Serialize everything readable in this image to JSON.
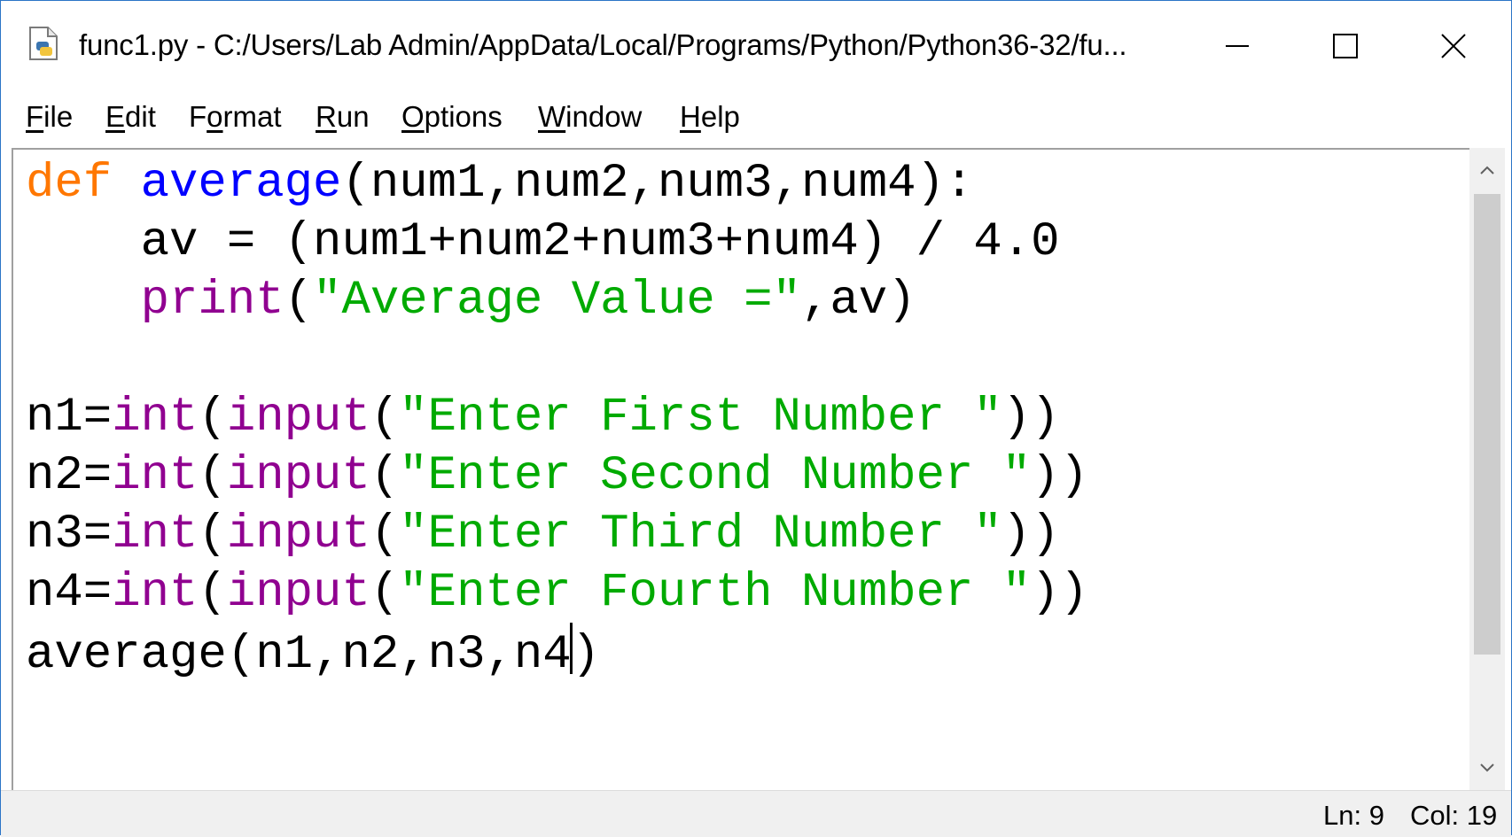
{
  "window": {
    "title": "func1.py - C:/Users/Lab Admin/AppData/Local/Programs/Python/Python36-32/fu...",
    "controls": {
      "minimize_icon": "minimize-icon",
      "maximize_icon": "maximize-icon",
      "close_icon": "close-icon"
    }
  },
  "menu": {
    "items": [
      {
        "accel": "F",
        "rest": "ile"
      },
      {
        "accel": "E",
        "rest": "dit"
      },
      {
        "pre": "F",
        "accel": "o",
        "rest": "rmat"
      },
      {
        "accel": "R",
        "rest": "un"
      },
      {
        "accel": "O",
        "rest": "ptions"
      },
      {
        "accel": "W",
        "rest": "indow"
      },
      {
        "accel": "H",
        "rest": "elp"
      }
    ]
  },
  "editor": {
    "lines": [
      {
        "segments": [
          {
            "t": "def",
            "c": "kw"
          },
          {
            "t": " ",
            "c": ""
          },
          {
            "t": "average",
            "c": "def"
          },
          {
            "t": "(num1,num2,num3,num4):",
            "c": ""
          }
        ]
      },
      {
        "segments": [
          {
            "t": "    av = (num1+num2+num3+num4) / 4.0",
            "c": ""
          }
        ]
      },
      {
        "segments": [
          {
            "t": "    ",
            "c": ""
          },
          {
            "t": "print",
            "c": "bi"
          },
          {
            "t": "(",
            "c": ""
          },
          {
            "t": "\"Average Value =\"",
            "c": "str"
          },
          {
            "t": ",av)",
            "c": ""
          }
        ]
      },
      {
        "segments": [
          {
            "t": "",
            "c": ""
          }
        ]
      },
      {
        "segments": [
          {
            "t": "n1=",
            "c": ""
          },
          {
            "t": "int",
            "c": "bi"
          },
          {
            "t": "(",
            "c": ""
          },
          {
            "t": "input",
            "c": "bi"
          },
          {
            "t": "(",
            "c": ""
          },
          {
            "t": "\"Enter First Number \"",
            "c": "str"
          },
          {
            "t": "))",
            "c": ""
          }
        ]
      },
      {
        "segments": [
          {
            "t": "n2=",
            "c": ""
          },
          {
            "t": "int",
            "c": "bi"
          },
          {
            "t": "(",
            "c": ""
          },
          {
            "t": "input",
            "c": "bi"
          },
          {
            "t": "(",
            "c": ""
          },
          {
            "t": "\"Enter Second Number \"",
            "c": "str"
          },
          {
            "t": "))",
            "c": ""
          }
        ]
      },
      {
        "segments": [
          {
            "t": "n3=",
            "c": ""
          },
          {
            "t": "int",
            "c": "bi"
          },
          {
            "t": "(",
            "c": ""
          },
          {
            "t": "input",
            "c": "bi"
          },
          {
            "t": "(",
            "c": ""
          },
          {
            "t": "\"Enter Third Number \"",
            "c": "str"
          },
          {
            "t": "))",
            "c": ""
          }
        ]
      },
      {
        "segments": [
          {
            "t": "n4=",
            "c": ""
          },
          {
            "t": "int",
            "c": "bi"
          },
          {
            "t": "(",
            "c": ""
          },
          {
            "t": "input",
            "c": "bi"
          },
          {
            "t": "(",
            "c": ""
          },
          {
            "t": "\"Enter Fourth Number \"",
            "c": "str"
          },
          {
            "t": "))",
            "c": ""
          }
        ]
      },
      {
        "segments": [
          {
            "t": "average(n1,n2,n3,n4",
            "c": ""
          },
          {
            "t": "",
            "c": "cursor"
          },
          {
            "t": ")",
            "c": ""
          }
        ]
      }
    ],
    "colors": {
      "keyword": "#ff7700",
      "definition": "#0000ff",
      "builtin": "#900090",
      "string": "#00aa00"
    }
  },
  "scrollbar": {
    "up_icon": "scroll-up-arrow-icon",
    "down_icon": "scroll-down-arrow-icon"
  },
  "status": {
    "line": "Ln: 9",
    "column": "Col: 19"
  }
}
